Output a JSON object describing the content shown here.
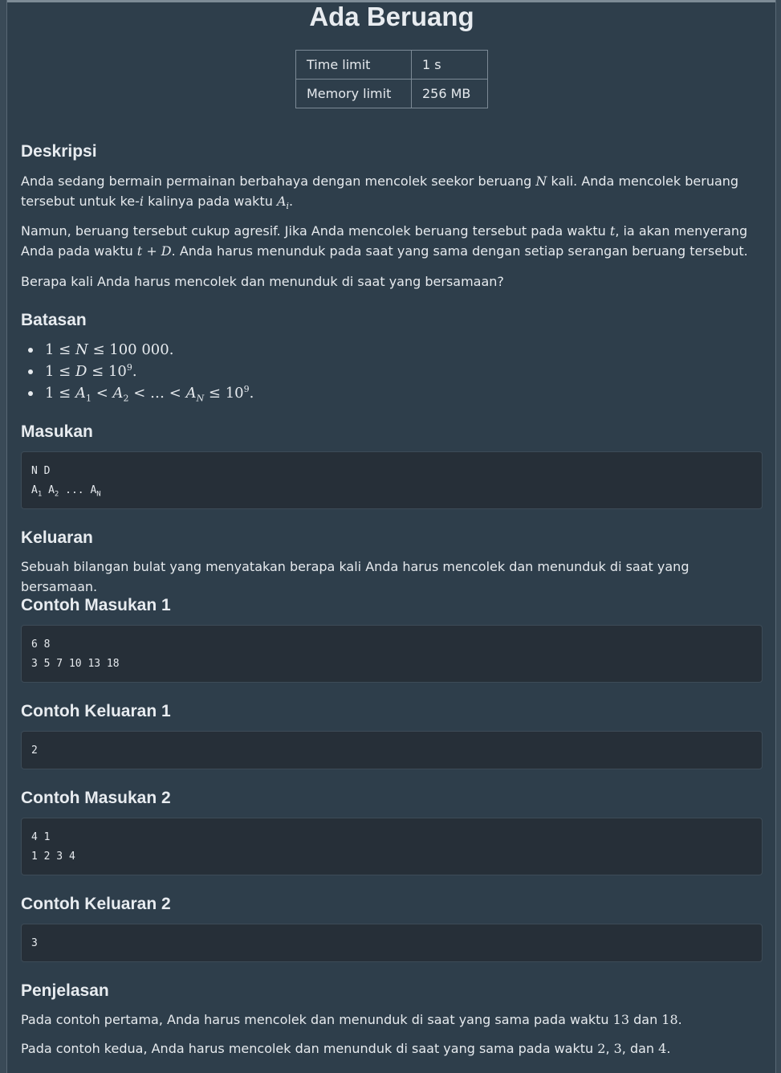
{
  "title": "Ada Beruang",
  "limits": [
    {
      "key": "Time limit",
      "value": "1 s"
    },
    {
      "key": "Memory limit",
      "value": "256 MB"
    }
  ],
  "sections": {
    "deskripsi": {
      "heading": "Deskripsi",
      "p1": {
        "a": "Anda sedang bermain permainan berbahaya dengan mencolek seekor beruang ",
        "N": "N",
        "b": " kali. Anda mencolek beruang tersebut untuk ke-",
        "i": "i",
        "c": " kalinya pada waktu ",
        "A": "A",
        "sub": "i",
        "d": "."
      },
      "p2": {
        "a": "Namun, beruang tersebut cukup agresif. Jika Anda mencolek beruang tersebut pada waktu ",
        "t": "t",
        "b": ", ia akan menyerang Anda pada waktu ",
        "expr": "t + D",
        "c": ". Anda harus menunduk pada saat yang sama dengan setiap serangan beruang tersebut."
      },
      "p3": "Berapa kali Anda harus mencolek dan menunduk di saat yang bersamaan?"
    },
    "batasan": {
      "heading": "Batasan",
      "items": [
        "1 ≤ N ≤ 100 000.",
        "1 ≤ D ≤ 10⁹.",
        "1 ≤ A₁ < A₂ < … < A_N ≤ 10⁹."
      ]
    },
    "masukan": {
      "heading": "Masukan",
      "line1": "N D",
      "line2": "A₁ A₂ ... A_N"
    },
    "keluaran": {
      "heading": "Keluaran",
      "text": "Sebuah bilangan bulat yang menyatakan berapa kali Anda harus mencolek dan menunduk di saat yang bersamaan."
    },
    "contoh_masukan_1": {
      "heading": "Contoh Masukan 1",
      "lines": [
        "6 8",
        "3 5 7 10 13 18"
      ]
    },
    "contoh_keluaran_1": {
      "heading": "Contoh Keluaran 1",
      "lines": [
        "2"
      ]
    },
    "contoh_masukan_2": {
      "heading": "Contoh Masukan 2",
      "lines": [
        "4 1",
        "1 2 3 4"
      ]
    },
    "contoh_keluaran_2": {
      "heading": "Contoh Keluaran 2",
      "lines": [
        "3"
      ]
    },
    "penjelasan": {
      "heading": "Penjelasan",
      "p1": {
        "a": "Pada contoh pertama, Anda harus mencolek dan menunduk di saat yang sama pada waktu ",
        "v": "13",
        "b": " dan ",
        "w": "18",
        "c": "."
      },
      "p2": {
        "a": "Pada contoh kedua, Anda harus mencolek dan menunduk di saat yang sama pada waktu ",
        "v1": "2",
        "s1": ", ",
        "v2": "3",
        "s2": ", dan ",
        "v3": "4",
        "c": "."
      }
    }
  },
  "colors": {
    "background": "#2e3e4b",
    "code_background": "#262f38",
    "text": "#e6eaee"
  }
}
